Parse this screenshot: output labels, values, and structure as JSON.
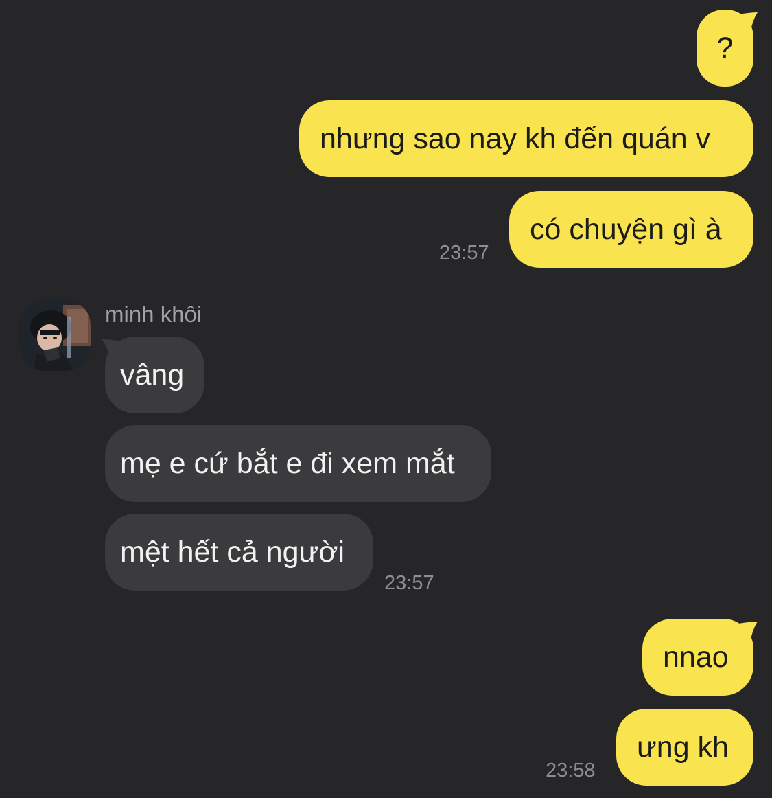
{
  "colors": {
    "background": "#262628",
    "sent_bubble": "#f9e34f",
    "received_bubble": "#3b3b3d",
    "timestamp": "#8e8e90"
  },
  "sent_group_1": {
    "messages": [
      "?",
      "nhưng sao nay kh đến quán v",
      "có chuyện gì à"
    ],
    "time": "23:57"
  },
  "received_group": {
    "sender_name": "minh khôi",
    "avatar_icon": "profile-photo",
    "messages": [
      "vâng",
      "mẹ e cứ bắt e đi xem mắt",
      "mệt hết cả người"
    ],
    "time": "23:57"
  },
  "sent_group_2": {
    "messages": [
      "nnao",
      "ưng kh"
    ],
    "time": "23:58"
  }
}
